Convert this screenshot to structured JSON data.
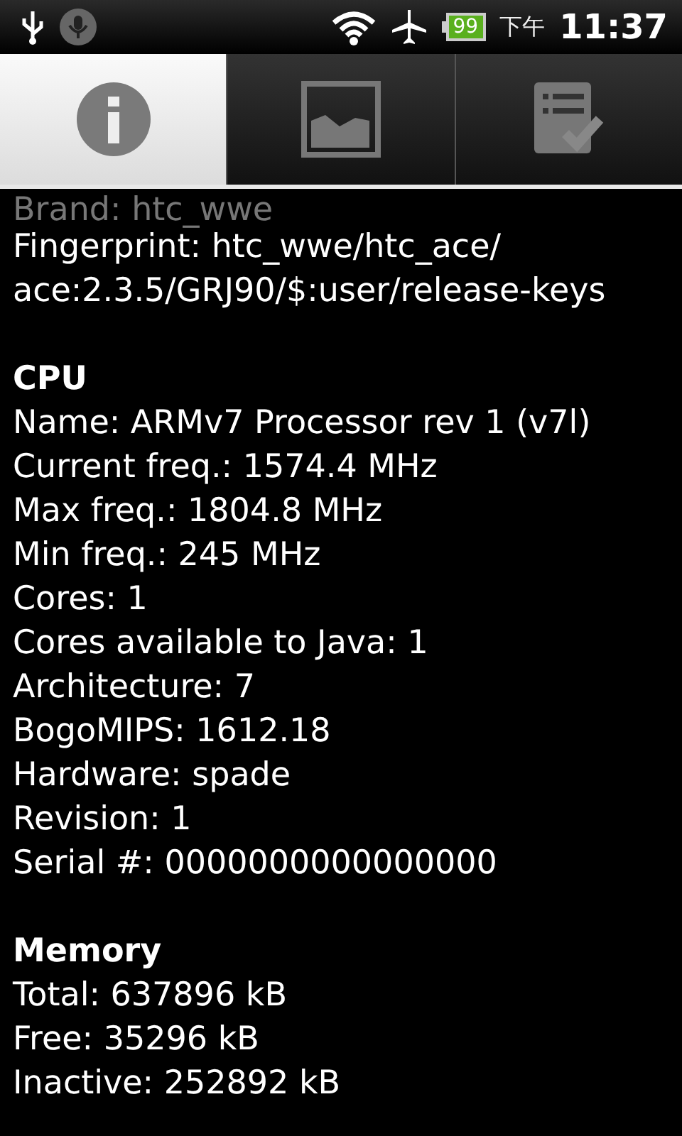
{
  "status_bar": {
    "battery": "99",
    "period": "下午",
    "time": "11:37"
  },
  "tabs": [
    {
      "kind": "info",
      "selected": true
    },
    {
      "kind": "image",
      "selected": false
    },
    {
      "kind": "checklist",
      "selected": false
    }
  ],
  "sections": [
    {
      "lines": [
        {
          "kind": "clipped",
          "text": "Brand: htc_wwe"
        },
        {
          "kind": "line",
          "text": "Fingerprint: htc_wwe/htc_ace/"
        },
        {
          "kind": "line",
          "text": "ace:2.3.5/GRJ90/$:user/release-keys"
        }
      ]
    },
    {
      "heading": "CPU",
      "lines": [
        {
          "kind": "line",
          "text": "Name: ARMv7 Processor rev 1 (v7l)"
        },
        {
          "kind": "line",
          "text": "Current freq.: 1574.4 MHz"
        },
        {
          "kind": "line",
          "text": "Max freq.: 1804.8 MHz"
        },
        {
          "kind": "line",
          "text": "Min freq.: 245 MHz"
        },
        {
          "kind": "line",
          "text": "Cores: 1"
        },
        {
          "kind": "line",
          "text": "Cores available to Java: 1"
        },
        {
          "kind": "line",
          "text": "Architecture: 7"
        },
        {
          "kind": "line",
          "text": "BogoMIPS: 1612.18"
        },
        {
          "kind": "line",
          "text": "Hardware: spade"
        },
        {
          "kind": "line",
          "text": "Revision: 1"
        },
        {
          "kind": "line",
          "text": "Serial #: 0000000000000000"
        }
      ]
    },
    {
      "heading": "Memory",
      "lines": [
        {
          "kind": "line",
          "text": "Total: 637896 kB"
        },
        {
          "kind": "line",
          "text": "Free: 35296 kB"
        },
        {
          "kind": "line",
          "text": "Inactive: 252892 kB"
        }
      ]
    }
  ]
}
